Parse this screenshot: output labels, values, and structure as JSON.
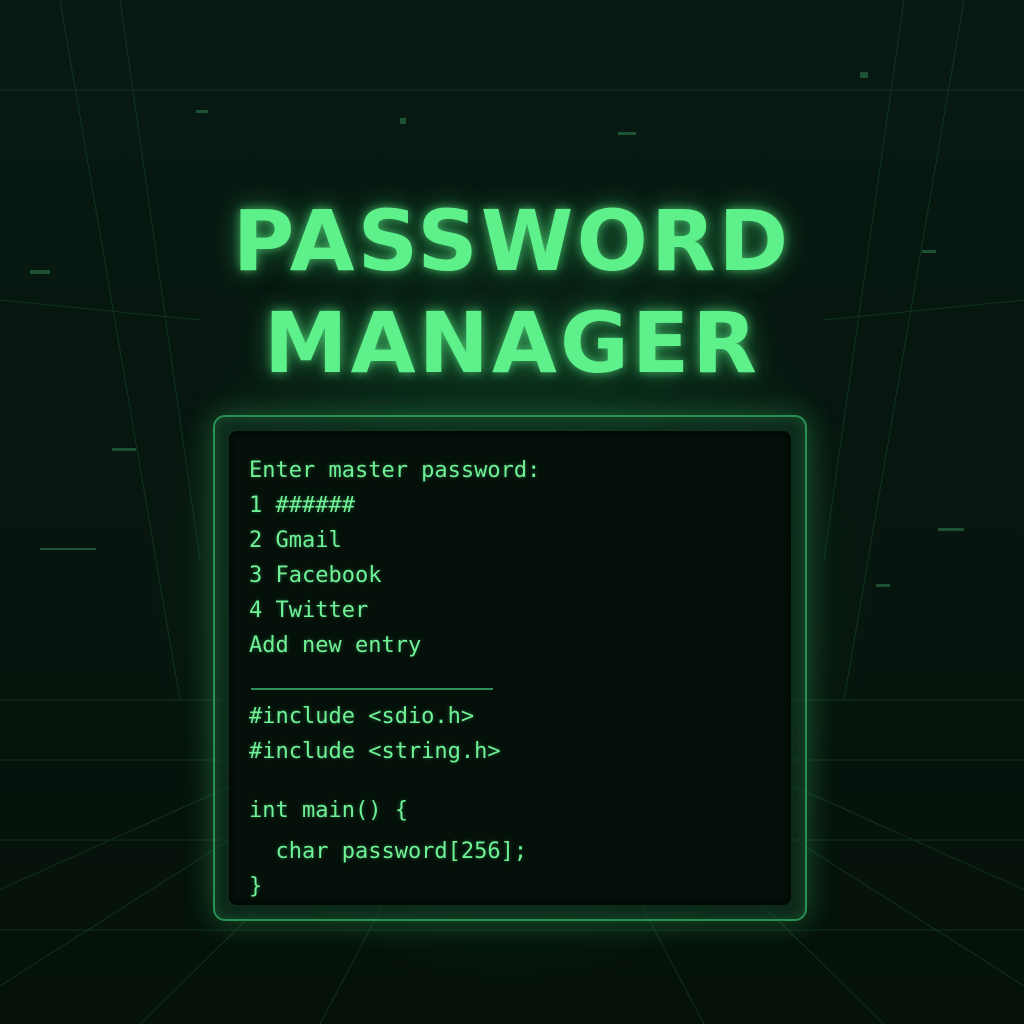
{
  "title": {
    "line1": "PASSWORD",
    "line2": "MANAGER"
  },
  "terminal": {
    "menu": [
      "Enter master password:",
      "1 ######",
      "2 Gmail",
      "3 Facebook",
      "4 Twitter",
      "Add new entry"
    ],
    "code": [
      "#include <sdio.h>",
      "#include <string.h>",
      "int main() {",
      "  char password[256];",
      "}"
    ]
  },
  "colors": {
    "accent": "#5ef08a",
    "background": "#061510",
    "terminal_bg": "#041009"
  }
}
